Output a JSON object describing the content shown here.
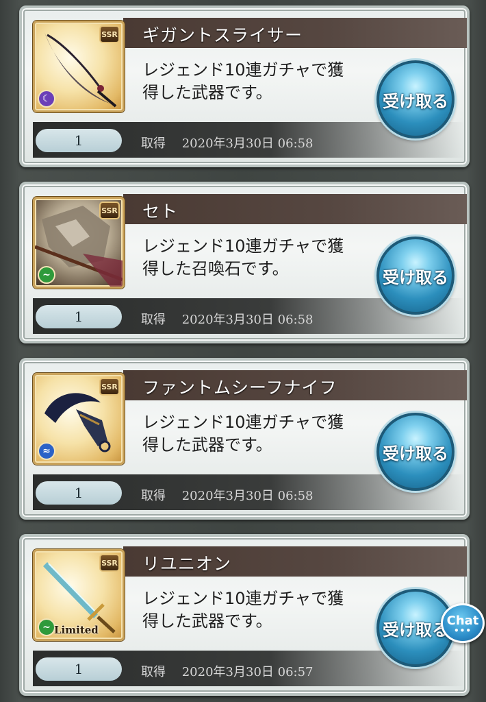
{
  "rewards": [
    {
      "name": "ギガントスライサー",
      "description_line1": "レジェンド10連ガチャで獲",
      "description_line2": "得した武器です。",
      "rarity": "SSR",
      "element_icon": "dark-element-icon",
      "element_color": "#6b3fb8",
      "limited_label": "",
      "quantity": "1",
      "acquired_label": "取得",
      "acquired_datetime": "2020年3月30日 06:58",
      "receive_label": "受け取る"
    },
    {
      "name": "セト",
      "description_line1": "レジェンド10連ガチャで獲",
      "description_line2": "得した召喚石です。",
      "rarity": "SSR",
      "element_icon": "wind-element-icon",
      "element_color": "#2f9a3b",
      "limited_label": "",
      "quantity": "1",
      "acquired_label": "取得",
      "acquired_datetime": "2020年3月30日 06:58",
      "receive_label": "受け取る"
    },
    {
      "name": "ファントムシーフナイフ",
      "description_line1": "レジェンド10連ガチャで獲",
      "description_line2": "得した武器です。",
      "rarity": "SSR",
      "element_icon": "water-element-icon",
      "element_color": "#2b62c7",
      "limited_label": "",
      "quantity": "1",
      "acquired_label": "取得",
      "acquired_datetime": "2020年3月30日 06:58",
      "receive_label": "受け取る"
    },
    {
      "name": "リユニオン",
      "description_line1": "レジェンド10連ガチャで獲",
      "description_line2": "得した武器です。",
      "rarity": "SSR",
      "element_icon": "wind-element-icon",
      "element_color": "#2f9a3b",
      "limited_label": "Limited",
      "quantity": "1",
      "acquired_label": "取得",
      "acquired_datetime": "2020年3月30日 06:57",
      "receive_label": "受け取る"
    }
  ],
  "chat_button": {
    "label": "Chat",
    "dots": "•••"
  }
}
